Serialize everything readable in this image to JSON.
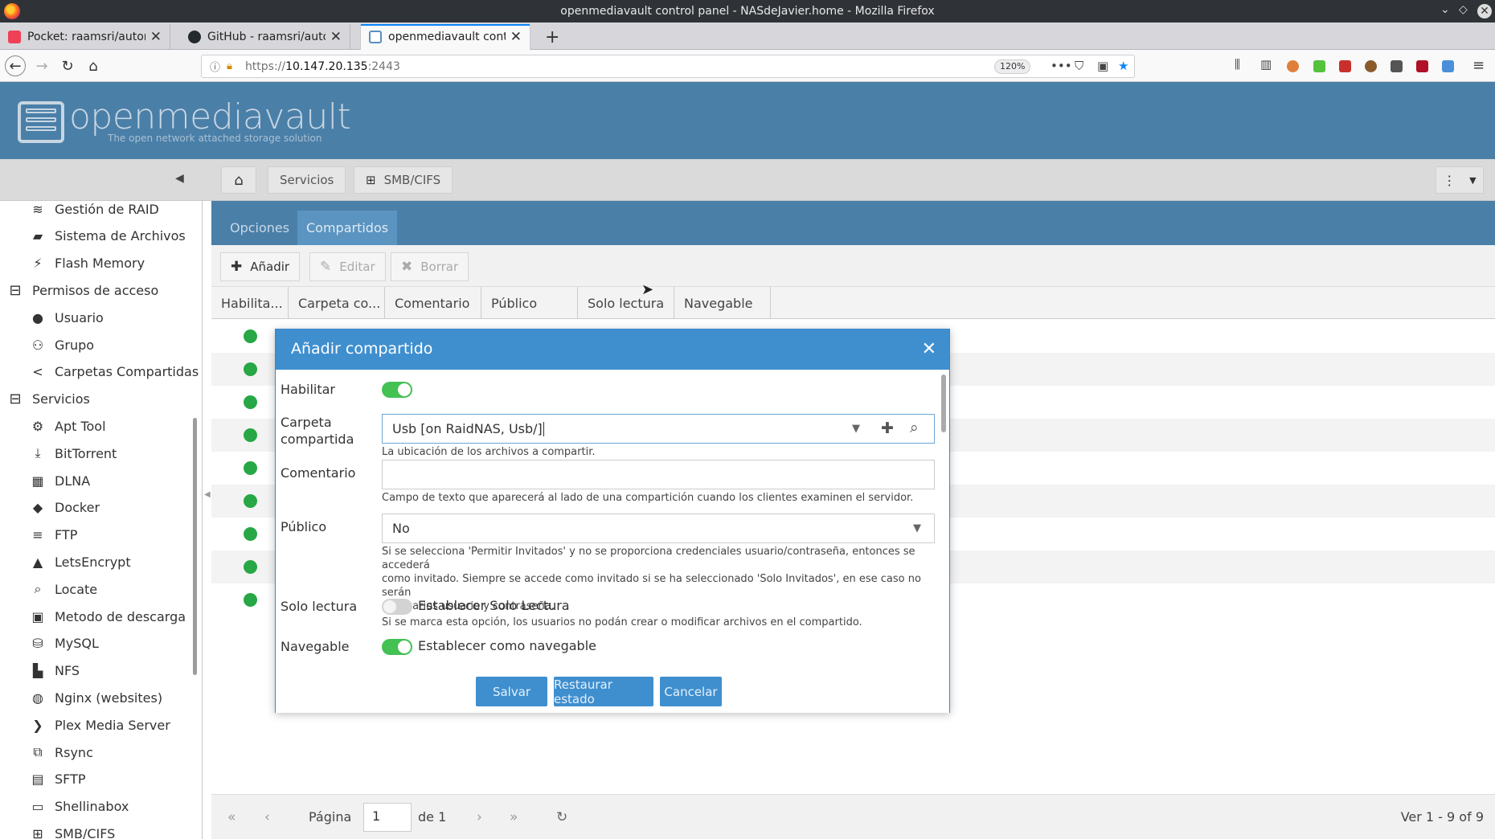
{
  "window": {
    "title": "openmediavault control panel - NASdeJavier.home - Mozilla Firefox"
  },
  "browser": {
    "tabs": [
      {
        "label": "Pocket: raamsri/automoun",
        "icon": "pocket-icon",
        "color": "#ef4056"
      },
      {
        "label": "GitHub - raamsri/automou",
        "icon": "github-icon",
        "color": "#24292e"
      },
      {
        "label": "openmediavault control pa",
        "icon": "page-icon",
        "color": "#5a8fc0"
      }
    ],
    "url_scheme": "https://",
    "url_host": "10.147.20.135",
    "url_port": ":2443",
    "zoom": "120%"
  },
  "omv": {
    "brand": "openmediavault",
    "tagline": "The open network attached storage solution",
    "breadcrumb": [
      "Servicios",
      "SMB/CIFS"
    ]
  },
  "sidebar": {
    "items": [
      {
        "label": "Gestión de RAID",
        "icon": "raid-icon",
        "glyph": "≋",
        "group": false
      },
      {
        "label": "Sistema de Archivos",
        "icon": "filesystem-icon",
        "glyph": "▰",
        "group": false
      },
      {
        "label": "Flash Memory",
        "icon": "flash-icon",
        "glyph": "⚡",
        "group": false
      },
      {
        "label": "Permisos de acceso",
        "icon": "collapse-icon",
        "glyph": "⊟",
        "group": true
      },
      {
        "label": "Usuario",
        "icon": "user-icon",
        "glyph": "●",
        "group": false
      },
      {
        "label": "Grupo",
        "icon": "group-icon",
        "glyph": "⚇",
        "group": false
      },
      {
        "label": "Carpetas Compartidas",
        "icon": "share-icon",
        "glyph": "<",
        "group": false
      },
      {
        "label": "Servicios",
        "icon": "collapse-icon",
        "glyph": "⊟",
        "group": true
      },
      {
        "label": "Apt Tool",
        "icon": "apt-icon",
        "glyph": "⚙",
        "group": false
      },
      {
        "label": "BitTorrent",
        "icon": "download-icon",
        "glyph": "⤓",
        "group": false
      },
      {
        "label": "DLNA",
        "icon": "film-icon",
        "glyph": "▦",
        "group": false
      },
      {
        "label": "Docker",
        "icon": "docker-icon",
        "glyph": "◆",
        "group": false
      },
      {
        "label": "FTP",
        "icon": "server-icon",
        "glyph": "≡",
        "group": false
      },
      {
        "label": "LetsEncrypt",
        "icon": "lock-icon",
        "glyph": "▲",
        "group": false
      },
      {
        "label": "Locate",
        "icon": "search-icon",
        "glyph": "⌕",
        "group": false
      },
      {
        "label": "Metodo de descarga",
        "icon": "download-box-icon",
        "glyph": "▣",
        "group": false
      },
      {
        "label": "MySQL",
        "icon": "database-icon",
        "glyph": "⛁",
        "group": false
      },
      {
        "label": "NFS",
        "icon": "desktop-icon",
        "glyph": "▙",
        "group": false
      },
      {
        "label": "Nginx (websites)",
        "icon": "globe-icon",
        "glyph": "◍",
        "group": false
      },
      {
        "label": "Plex Media Server",
        "icon": "plex-icon",
        "glyph": "❯",
        "group": false
      },
      {
        "label": "Rsync",
        "icon": "rsync-icon",
        "glyph": "⧉",
        "group": false
      },
      {
        "label": "SFTP",
        "icon": "terminal-icon",
        "glyph": "▤",
        "group": false
      },
      {
        "label": "Shellinabox",
        "icon": "shell-icon",
        "glyph": "▭",
        "group": false
      },
      {
        "label": "SMB/CIFS",
        "icon": "windows-icon",
        "glyph": "⊞",
        "group": false
      }
    ]
  },
  "panel": {
    "tabs": [
      "Opciones",
      "Compartidos"
    ],
    "actions": {
      "add": "Añadir",
      "edit": "Editar",
      "delete": "Borrar"
    },
    "columns": [
      "Habilita...",
      "Carpeta co...",
      "Comentario",
      "Público",
      "Solo lectura",
      "Navegable"
    ],
    "row_count": 9,
    "pager": {
      "page_label": "Página",
      "page": "1",
      "of": "de 1",
      "info": "Ver 1 - 9 of 9"
    }
  },
  "dialog": {
    "title": "Añadir compartido",
    "fields": {
      "enable": {
        "label": "Habilitar",
        "on": true
      },
      "folder": {
        "label_line1": "Carpeta",
        "label_line2": "compartida",
        "value": "Usb [on RaidNAS, Usb/]",
        "help": "La ubicación de los archivos a compartir."
      },
      "comment": {
        "label": "Comentario",
        "value": "",
        "help": "Campo de texto que aparecerá al lado de una compartición cuando los clientes examinen el servidor."
      },
      "public": {
        "label": "Público",
        "value": "No",
        "help_line1": "Si se selecciona 'Permitir Invitados' y no se proporciona credenciales usuario/contraseña, entonces se accederá",
        "help_line2": "como invitado. Siempre se accede como invitado si se ha seleccionado 'Solo Invitados', en ese caso no serán",
        "help_line3": "necesarios usuario y contraseña."
      },
      "readonly": {
        "label": "Solo lectura",
        "toggle_label": "Establecer Solo Lectura",
        "on": false,
        "help": "Si se marca esta opción, los usuarios no podán crear o modificar archivos en el compartido."
      },
      "browseable": {
        "label": "Navegable",
        "toggle_label": "Establecer como navegable",
        "on": true
      }
    },
    "buttons": {
      "save": "Salvar",
      "reset": "Restaurar estado",
      "cancel": "Cancelar"
    }
  },
  "colors": {
    "omv_header": "#4a7fa8",
    "dialog_header": "#3f8fcf",
    "toggle_on": "#43c153",
    "status_enabled": "#27a745"
  }
}
